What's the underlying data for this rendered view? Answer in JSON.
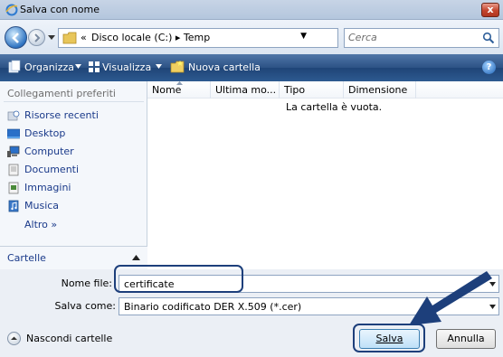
{
  "window": {
    "title": "Salva con nome",
    "close_label": "x"
  },
  "address": {
    "prefix": "«",
    "crumbs": "Disco locale (C:)  ▸  Temp",
    "search_placeholder": "Cerca"
  },
  "toolbar": {
    "organize": "Organizza",
    "view": "Visualizza",
    "new_folder": "Nuova cartella",
    "help": "?"
  },
  "left_pane": {
    "header": "Collegamenti preferiti",
    "items": [
      {
        "label": "Risorse recenti",
        "icon": "recent-icon"
      },
      {
        "label": "Desktop",
        "icon": "desktop-icon"
      },
      {
        "label": "Computer",
        "icon": "computer-icon"
      },
      {
        "label": "Documenti",
        "icon": "documents-icon"
      },
      {
        "label": "Immagini",
        "icon": "pictures-icon"
      },
      {
        "label": "Musica",
        "icon": "music-icon"
      }
    ],
    "more": "Altro  »",
    "folders": "Cartelle"
  },
  "file_list": {
    "columns": [
      "Nome",
      "Ultima mo...",
      "Tipo",
      "Dimensione"
    ],
    "empty_message": "La cartella è vuota."
  },
  "form": {
    "filename_label": "Nome file:",
    "filename_value": "certificate",
    "savetype_label": "Salva come:",
    "savetype_value": "Binario codificato DER X.509 (*.cer)",
    "hide_folders": "Nascondi cartelle",
    "save_button": "Salva",
    "cancel_button": "Annulla"
  },
  "colors": {
    "accent": "#1d3f7b",
    "toolbar": "#2c5285",
    "link": "#1a3a8a"
  }
}
